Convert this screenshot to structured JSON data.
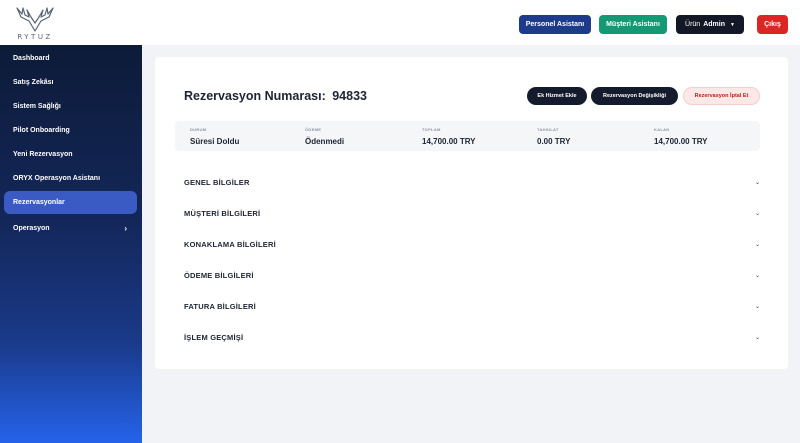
{
  "brand": {
    "name": "RYTUZ"
  },
  "topbar": {
    "personel_label": "Personel Asistanı",
    "musteri_label": "Müşteri Asistanı",
    "urun_prefix": "Ürün",
    "urun_user": "Admin",
    "cikis_label": "Çıkış"
  },
  "sidebar": {
    "items": [
      {
        "label": "Dashboard"
      },
      {
        "label": "Satış Zekâsı"
      },
      {
        "label": "Sistem Sağlığı"
      },
      {
        "label": "Pilot Onboarding"
      },
      {
        "label": "Yeni Rezervasyon"
      },
      {
        "label": "ORYX Operasyon Asistanı"
      },
      {
        "label": "Rezervasyonlar",
        "active": true
      },
      {
        "label": "Operasyon",
        "chevron": "›"
      }
    ]
  },
  "reservation": {
    "title_prefix": "Rezervasyon Numarası:",
    "number": "94833",
    "actions": {
      "ek_hizmet": "Ek Hizmet Ekle",
      "degisiklik": "Rezervasyon Değişikliği",
      "iptal": "Rezervasyon İptal Et"
    },
    "summary": [
      {
        "label": "DURUM",
        "value": "Süresi Doldu"
      },
      {
        "label": "ÖDEME",
        "value": "Ödenmedi"
      },
      {
        "label": "TOPLAM",
        "value": "14,700.00 TRY"
      },
      {
        "label": "TAHSILAT",
        "value": "0.00 TRY"
      },
      {
        "label": "KALAN",
        "value": "14,700.00 TRY"
      }
    ],
    "sections": [
      {
        "title": "GENEL BİLGİLER"
      },
      {
        "title": "MÜŞTERİ BİLGİLERİ"
      },
      {
        "title": "KONAKLAMA BİLGİLERİ"
      },
      {
        "title": "ÖDEME BİLGİLERİ"
      },
      {
        "title": "FATURA BİLGİLERİ"
      },
      {
        "title": "İŞLEM GEÇMİŞİ"
      }
    ],
    "section_chevron": "⌄"
  },
  "colors": {
    "accent_navy": "#1e3a8a",
    "accent_green": "#139a74",
    "danger": "#dc2626",
    "sidebar_active": "#3b5bc4"
  }
}
